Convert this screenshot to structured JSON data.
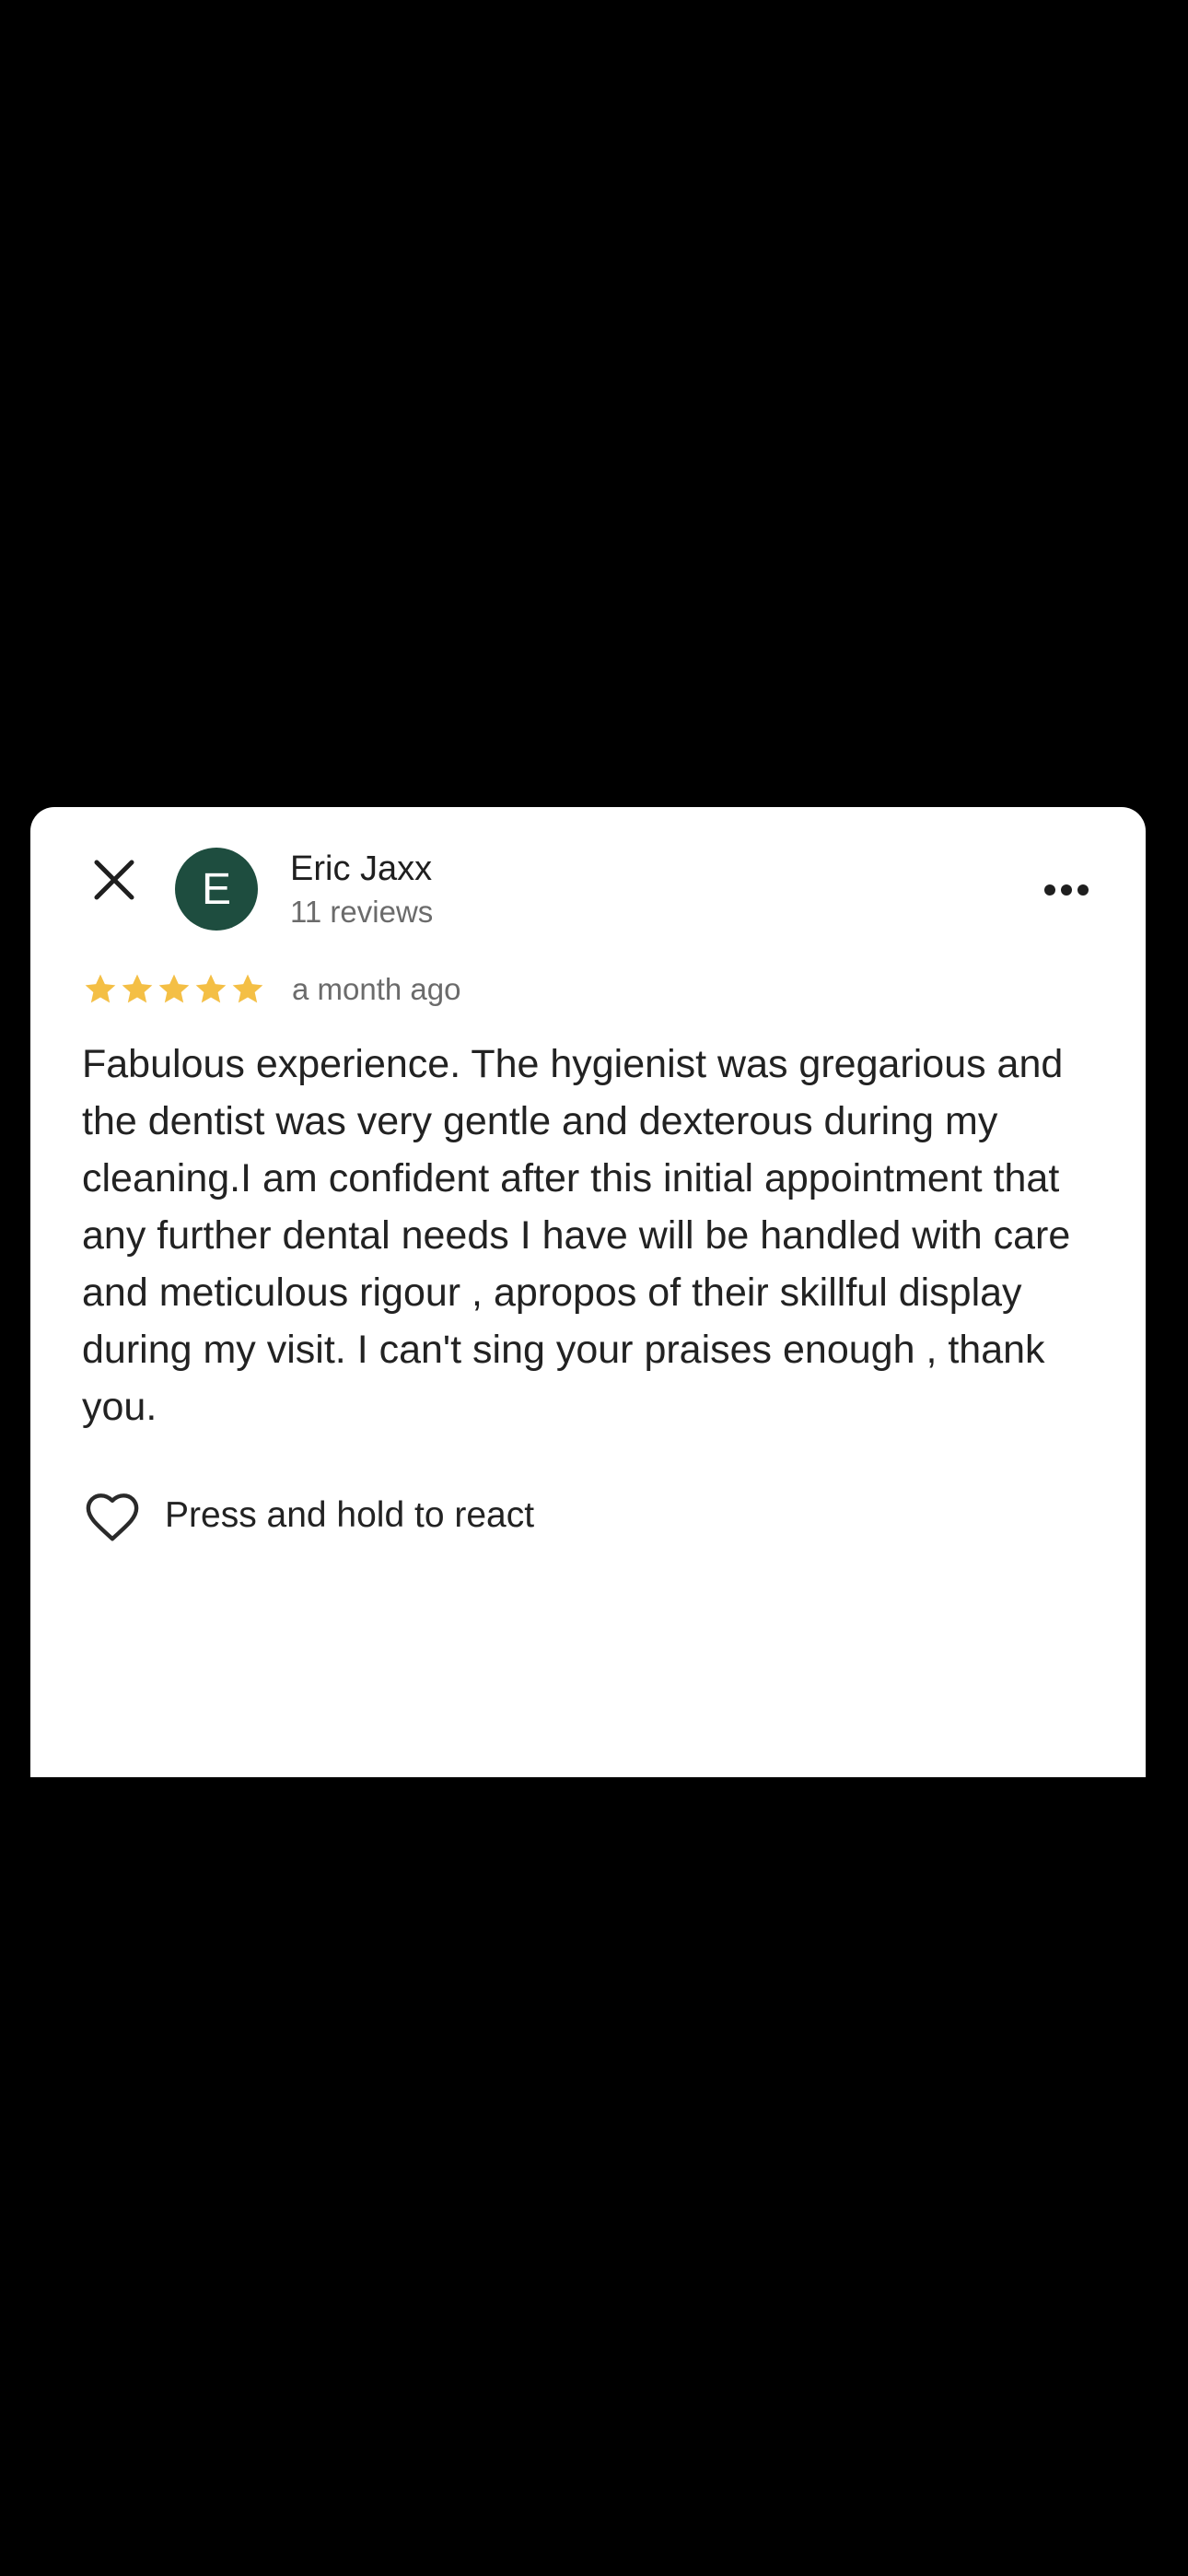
{
  "review": {
    "author": {
      "initial": "E",
      "name": "Eric Jaxx",
      "meta": "11 reviews",
      "avatar_color": "#1e4d3f"
    },
    "rating": 5,
    "max_rating": 5,
    "star_color": "#f4bf45",
    "date": "a month ago",
    "text": "Fabulous experience. The hygienist was gregarious and the dentist was very gentle and dexterous during my cleaning.I am confident after this initial appointment that any further dental needs I have will be handled with care and meticulous rigour , apropos of their skillful display during my visit. I can't sing your praises enough , thank you.",
    "react_label": "Press and hold to react"
  },
  "icons": {
    "close": "close-icon",
    "more": "more-horizontal-icon",
    "star": "star-icon",
    "heart": "heart-outline-icon"
  }
}
